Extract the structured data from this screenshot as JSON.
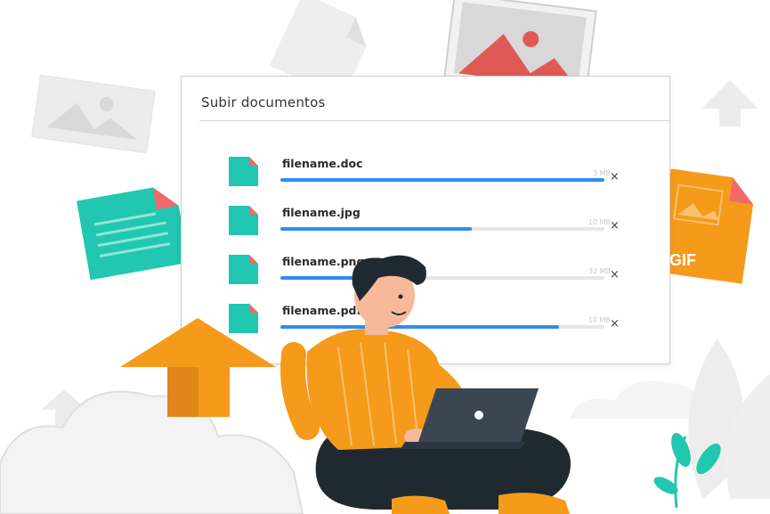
{
  "dialog": {
    "title": "Subir documentos",
    "close_symbol": "×"
  },
  "files": [
    {
      "name": "filename.doc",
      "size": "3 MB",
      "progress": 1.0
    },
    {
      "name": "filename.jpg",
      "size": "10 MB",
      "progress": 0.59
    },
    {
      "name": "filename.png",
      "size": "32 MB",
      "progress": 0.25
    },
    {
      "name": "filename.pdf",
      "size": "10 MB",
      "progress": 0.86
    }
  ],
  "badge": {
    "text": "GIF"
  },
  "colors": {
    "accent_orange": "#f59a1b",
    "file_teal": "#21c7b0",
    "file_corner": "#f16a6a",
    "progress_blue": "#2f8cf0",
    "laptop": "#3a4752",
    "pants": "#1f2a30"
  }
}
